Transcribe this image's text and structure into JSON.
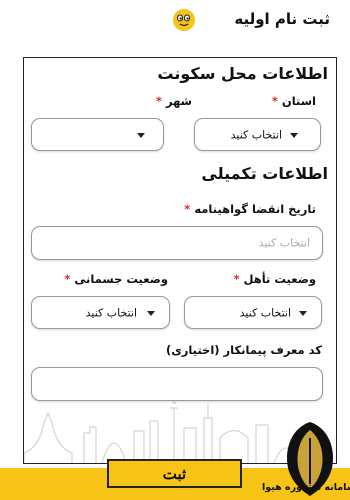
{
  "header": {
    "title": "ثبت نام اولیه",
    "logo": "smiley-logo-icon"
  },
  "residence": {
    "title": "اطلاعات محل سکونت",
    "province": {
      "label": "استان",
      "value": "انتخاب کنید"
    },
    "city": {
      "label": "شهر",
      "value": ""
    }
  },
  "extra": {
    "title": "اطلاعات تکمیلی",
    "license_expiry": {
      "label": "تاریخ انقضا گواهینامه",
      "placeholder": "انتخاب کنید"
    },
    "marital": {
      "label": "وضعیت تأهل",
      "value": "انتخاب کنید"
    },
    "physical": {
      "label": "وضعیت جسمانی",
      "value": "انتخاب کنید"
    },
    "contractor_code": {
      "label": "کد معرف پیمانکار (اختیاری)",
      "value": ""
    }
  },
  "required_mark": "*",
  "submit_label": "ثبت",
  "watermark_text": "سامانه مشاوره هیوا",
  "colors": {
    "accent": "#f6c417",
    "required": "#d32f2f",
    "border": "#222222"
  }
}
